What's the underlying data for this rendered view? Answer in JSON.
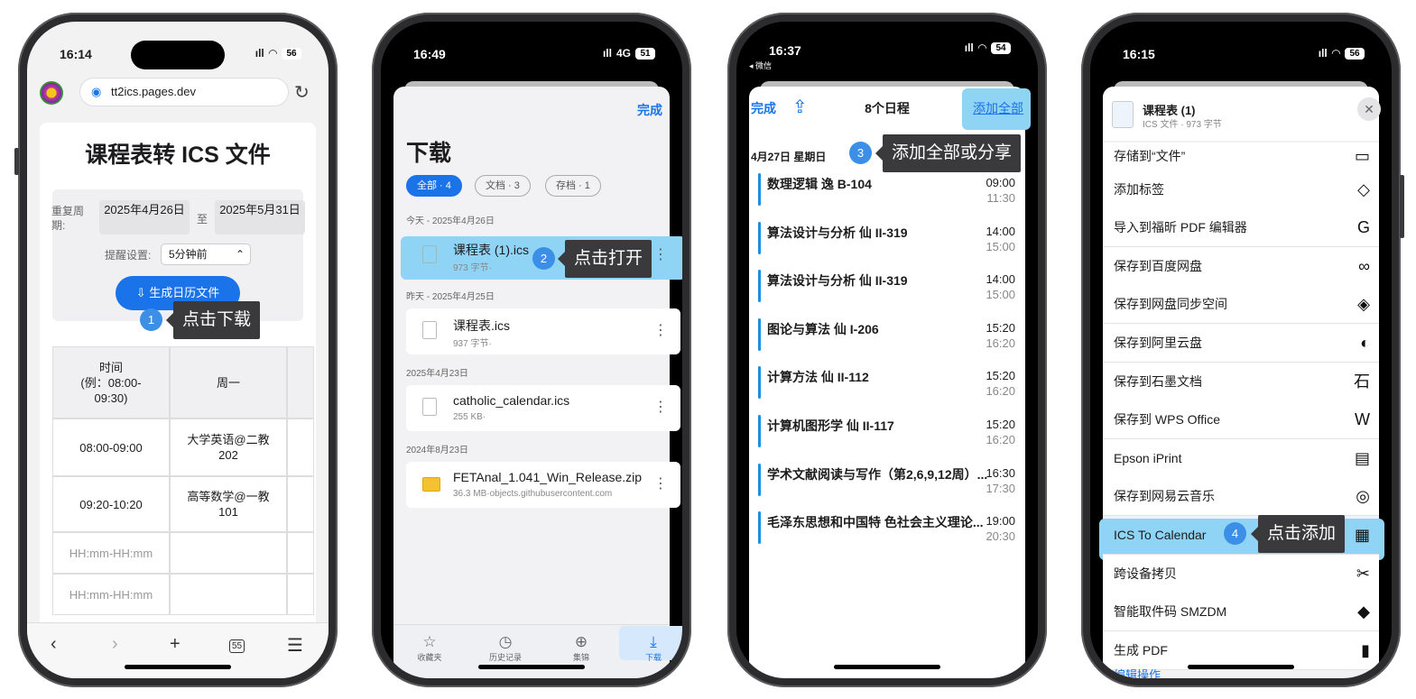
{
  "phone1": {
    "status": {
      "time": "16:14",
      "signal": "ıll",
      "battery": "56"
    },
    "url": "tt2ics.pages.dev",
    "title": "课程表转 ICS 文件",
    "repeat_label": "重复周期:",
    "date_from": "2025年4月26日",
    "to_label": "至",
    "date_to": "2025年5月31日",
    "reminder_label": "提醒设置:",
    "reminder_value": "5分钟前",
    "generate_button": "生成日历文件",
    "step": "1",
    "tip": "点击下载",
    "table": {
      "headers": [
        "时间\n(例：08:00-\n09:30)",
        "周一"
      ],
      "rows": [
        [
          "08:00-09:00",
          "大学英语@二教\n202"
        ],
        [
          "09:20-10:20",
          "高等数学@一教\n101"
        ],
        [
          "HH:mm-HH:mm",
          ""
        ],
        [
          "HH:mm-HH:mm",
          ""
        ]
      ]
    },
    "toolbar": {
      "back": "‹",
      "forward": "›",
      "add": "+",
      "tabs": "55",
      "menu": "☰"
    }
  },
  "phone2": {
    "status": {
      "time": "16:49",
      "network": "4G",
      "battery": "51"
    },
    "done": "完成",
    "title": "下载",
    "chips": [
      "全部 · 4",
      "文档 · 3",
      "存档 · 1"
    ],
    "sections": [
      {
        "label": "今天 - 2025年4月26日",
        "name": "课程表 (1).ics",
        "sub": "973 字节·"
      },
      {
        "label": "昨天 - 2025年4月25日",
        "name": "课程表.ics",
        "sub": "937 字节·"
      },
      {
        "label": "2025年4月23日",
        "name": "catholic_calendar.ics",
        "sub": "255 KB·"
      },
      {
        "label": "2024年8月23日",
        "name": "FETAnal_1.041_Win_Release.zip",
        "sub": "36.3 MB·objects.githubusercontent.com"
      }
    ],
    "step": "2",
    "tip": "点击打开",
    "tabs": [
      "收藏夹",
      "历史记录",
      "集锦",
      "下载"
    ]
  },
  "phone3": {
    "status": {
      "time": "16:37",
      "back_app": "◂ 微信",
      "battery": "54"
    },
    "done": "完成",
    "count": "8个日程",
    "add_all": "添加全部",
    "date_header": "4月27日 星期日",
    "step": "3",
    "tip": "添加全部或分享",
    "events": [
      {
        "title": "数理逻辑 逸 B-104",
        "start": "09:00",
        "end": "11:30"
      },
      {
        "title": "算法设计与分析 仙 II-319",
        "start": "14:00",
        "end": "15:00"
      },
      {
        "title": "算法设计与分析 仙 II-319",
        "start": "14:00",
        "end": "15:00"
      },
      {
        "title": "图论与算法 仙 I-206",
        "start": "15:20",
        "end": "16:20"
      },
      {
        "title": "计算方法 仙 II-112",
        "start": "15:20",
        "end": "16:20"
      },
      {
        "title": "计算机图形学 仙 II-117",
        "start": "15:20",
        "end": "16:20"
      },
      {
        "title": "学术文献阅读与写作（第2,6,9,12周）...",
        "start": "16:30",
        "end": "17:30"
      },
      {
        "title": "毛泽东思想和中国特 色社会主义理论...",
        "start": "19:00",
        "end": "20:30"
      }
    ]
  },
  "phone4": {
    "status": {
      "time": "16:15",
      "battery": "56"
    },
    "file_name": "课程表 (1)",
    "file_sub": "ICS 文件 · 973 字节",
    "rows": [
      {
        "label": "存储到“文件”",
        "icon": "▭"
      },
      {
        "label": "添加标签",
        "icon": "◇"
      },
      {
        "label": "导入到福昕 PDF 编辑器",
        "icon": "G"
      },
      {
        "label": "保存到百度网盘",
        "icon": "∞"
      },
      {
        "label": "保存到网盘同步空间",
        "icon": "◈"
      },
      {
        "label": "保存到阿里云盘",
        "icon": "◐"
      },
      {
        "label": "保存到石墨文档",
        "icon": "石"
      },
      {
        "label": "保存到 WPS Office",
        "icon": "W"
      },
      {
        "label": "Epson iPrint",
        "icon": "▤"
      },
      {
        "label": "保存到网易云音乐",
        "icon": "◎"
      },
      {
        "label": "ICS To Calendar",
        "icon": "▦"
      },
      {
        "label": "跨设备拷贝",
        "icon": "✂"
      },
      {
        "label": "智能取件码 SMZDM",
        "icon": "◆"
      },
      {
        "label": "生成 PDF",
        "icon": "▮"
      }
    ],
    "cut_off": "编辑操作",
    "step": "4",
    "tip": "点击添加"
  }
}
